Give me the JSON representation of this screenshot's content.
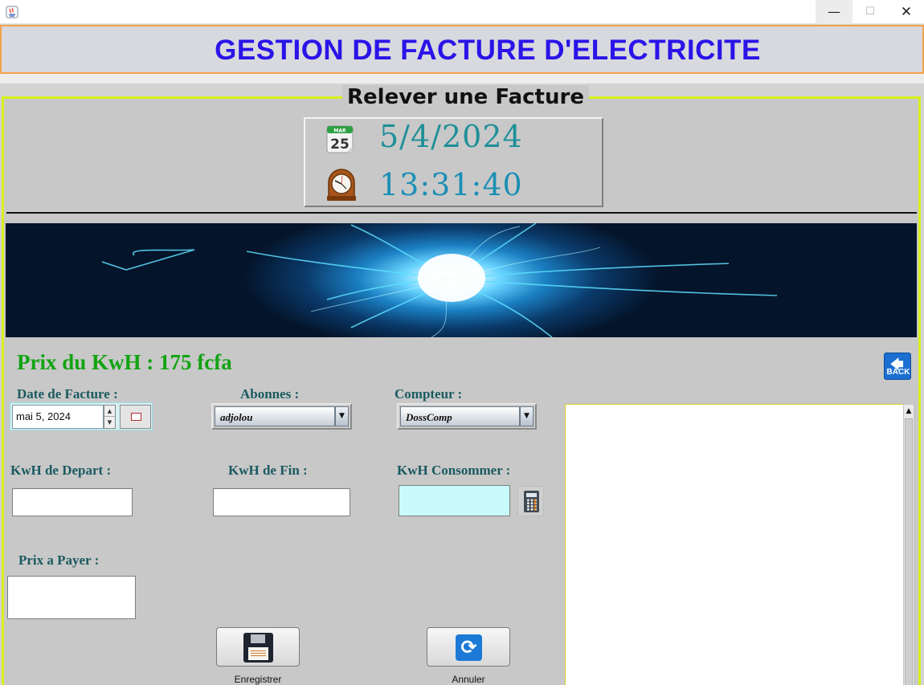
{
  "window": {
    "icon": "java-app-icon",
    "minimize_glyph": "—",
    "maximize_glyph": "☐",
    "close_glyph": "✕"
  },
  "header": {
    "title": "GESTION DE FACTURE D'ELECTRICITE"
  },
  "panel": {
    "title": "Relever une Facture"
  },
  "clock": {
    "calendar_icon": {
      "month": "MAR",
      "day": "25"
    },
    "date": "5/4/2024",
    "time": "13:31:40"
  },
  "banner": {
    "image": "electric-spark-banner"
  },
  "price": {
    "label": "Prix du KwH : 175 fcfa"
  },
  "back_button": {
    "arrow": "🡄",
    "label": "BACK"
  },
  "form": {
    "date_facture": {
      "label": "Date de Facture :",
      "value": "mai 5, 2024"
    },
    "abonnes": {
      "label": "Abonnes :",
      "selected": "adjolou"
    },
    "compteur": {
      "label": "Compteur :",
      "selected": "DossComp"
    },
    "kwh_depart": {
      "label": "KwH de Depart :",
      "value": ""
    },
    "kwh_fin": {
      "label": "KwH de Fin :",
      "value": ""
    },
    "kwh_consommer": {
      "label": "KwH Consommer :",
      "value": ""
    },
    "prix_payer": {
      "label": "Prix a Payer :",
      "value": ""
    }
  },
  "buttons": {
    "save": {
      "label": "Enregistrer",
      "icon": "floppy-disk-icon"
    },
    "cancel": {
      "label": "Annuler",
      "icon": "refresh-icon",
      "glyph": "⟳"
    }
  },
  "output": {
    "text": ""
  },
  "colors": {
    "header_title": "#2a14e8",
    "header_border": "#f5a24a",
    "panel_border": "#d9f01a",
    "price": "#11a312",
    "labels": "#1a5a60",
    "date": "#1f8f99",
    "time": "#1a8fb5"
  }
}
